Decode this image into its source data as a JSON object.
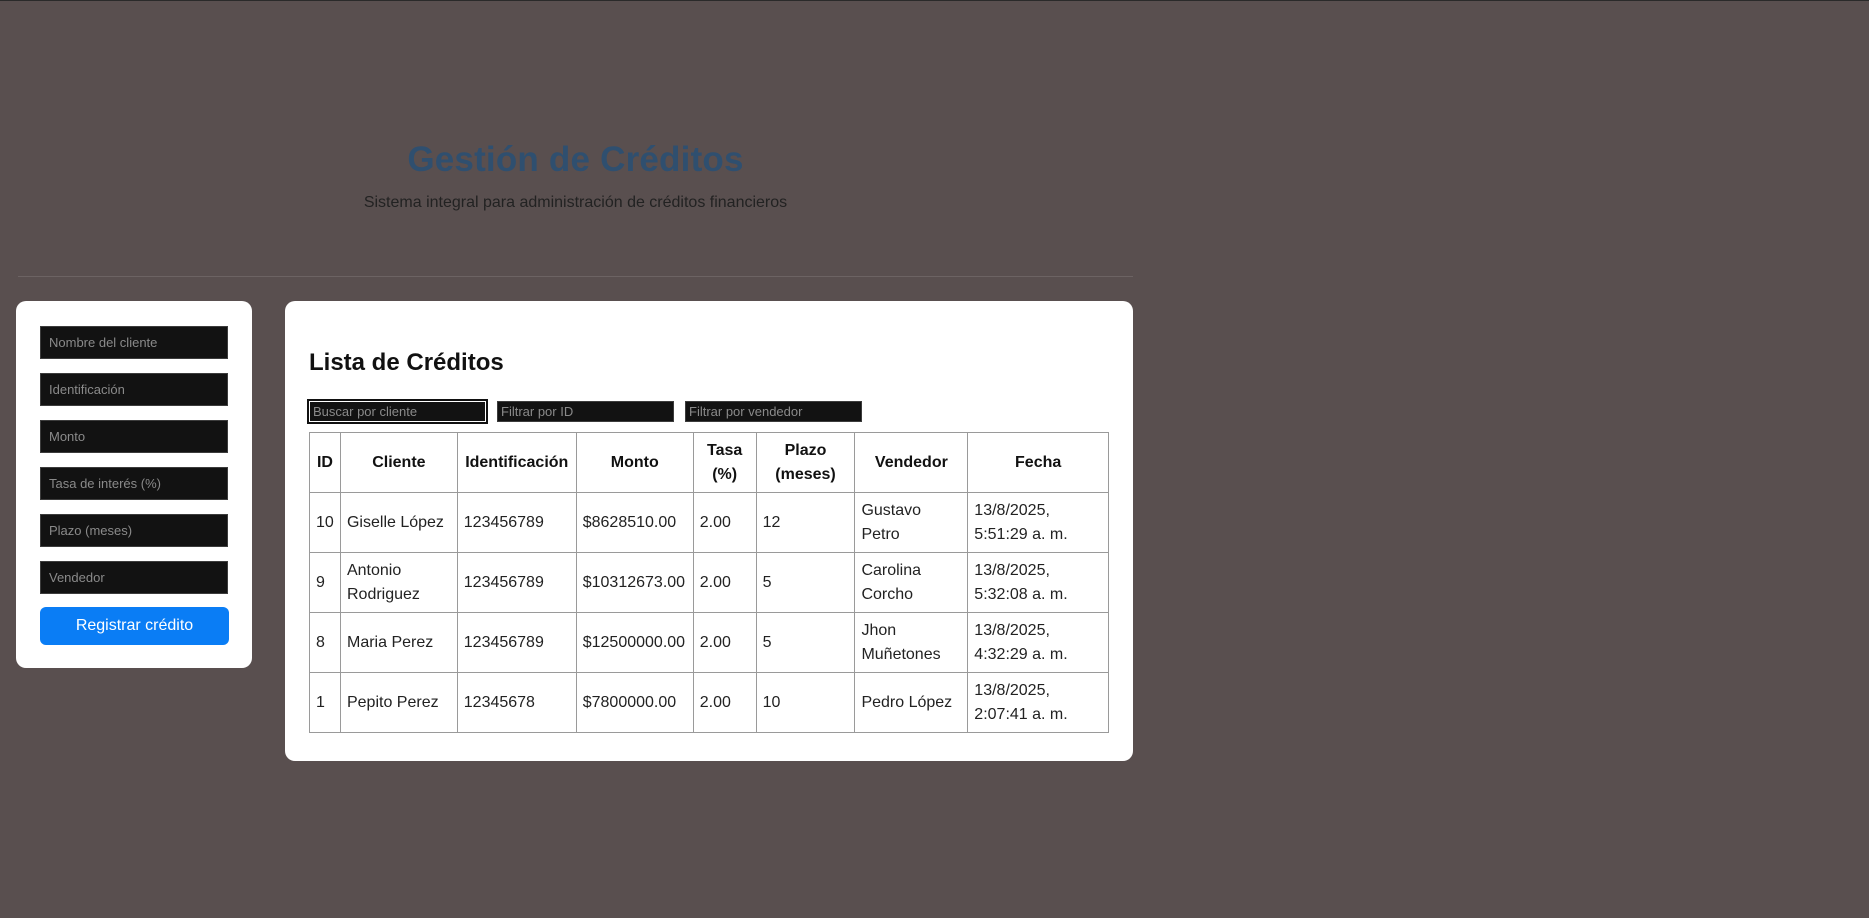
{
  "header": {
    "title": "Gestión de Créditos",
    "subtitle": "Sistema integral para administración de créditos financieros"
  },
  "form": {
    "fields": [
      {
        "placeholder": "Nombre del cliente"
      },
      {
        "placeholder": "Identificación"
      },
      {
        "placeholder": "Monto"
      },
      {
        "placeholder": "Tasa de interés (%)"
      },
      {
        "placeholder": "Plazo (meses)"
      },
      {
        "placeholder": "Vendedor"
      }
    ],
    "submit_label": "Registrar crédito"
  },
  "list": {
    "title": "Lista de Créditos",
    "filters": {
      "cliente_placeholder": "Buscar por cliente",
      "id_placeholder": "Filtrar por ID",
      "vendedor_placeholder": "Filtrar por vendedor"
    },
    "columns": [
      "ID",
      "Cliente",
      "Identificación",
      "Monto",
      "Tasa (%)",
      "Plazo (meses)",
      "Vendedor",
      "Fecha"
    ],
    "rows": [
      {
        "id": "10",
        "cliente": "Giselle López",
        "identificacion": "123456789",
        "monto": "$8628510.00",
        "tasa": "2.00",
        "plazo": "12",
        "vendedor": "Gustavo Petro",
        "fecha": "13/8/2025, 5:51:29 a. m."
      },
      {
        "id": "9",
        "cliente": "Antonio Rodriguez",
        "identificacion": "123456789",
        "monto": "$10312673.00",
        "tasa": "2.00",
        "plazo": "5",
        "vendedor": "Carolina Corcho",
        "fecha": "13/8/2025, 5:32:08 a. m."
      },
      {
        "id": "8",
        "cliente": "Maria Perez",
        "identificacion": "123456789",
        "monto": "$12500000.00",
        "tasa": "2.00",
        "plazo": "5",
        "vendedor": "Jhon Muñetones",
        "fecha": "13/8/2025, 4:32:29 a. m."
      },
      {
        "id": "1",
        "cliente": "Pepito Perez",
        "identificacion": "12345678",
        "monto": "$7800000.00",
        "tasa": "2.00",
        "plazo": "10",
        "vendedor": "Pedro López",
        "fecha": "13/8/2025, 2:07:41 a. m."
      }
    ]
  },
  "colors": {
    "background": "#594f4f",
    "title": "#2f4f6f",
    "accent": "#0a7df5",
    "input_bg": "#121212"
  }
}
